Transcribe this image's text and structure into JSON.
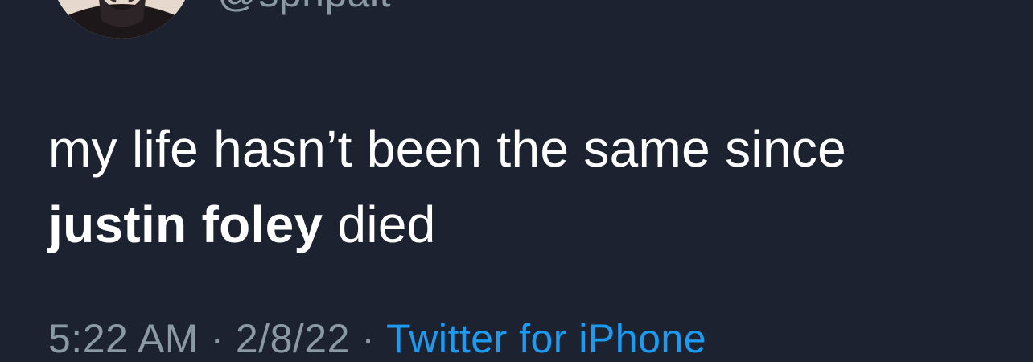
{
  "author": {
    "handle": "@sphpait"
  },
  "tweet": {
    "text_part1": "my life hasn’t been the same since ",
    "text_bold": "justin foley",
    "text_part2": " died"
  },
  "meta": {
    "time": "5:22 AM",
    "separator1": " · ",
    "date": "2/8/22",
    "separator2": " · ",
    "source": "Twitter for iPhone"
  },
  "colors": {
    "background": "#1c2230",
    "text": "#ffffff",
    "muted": "#8b98a5",
    "link": "#1d9bf0"
  }
}
